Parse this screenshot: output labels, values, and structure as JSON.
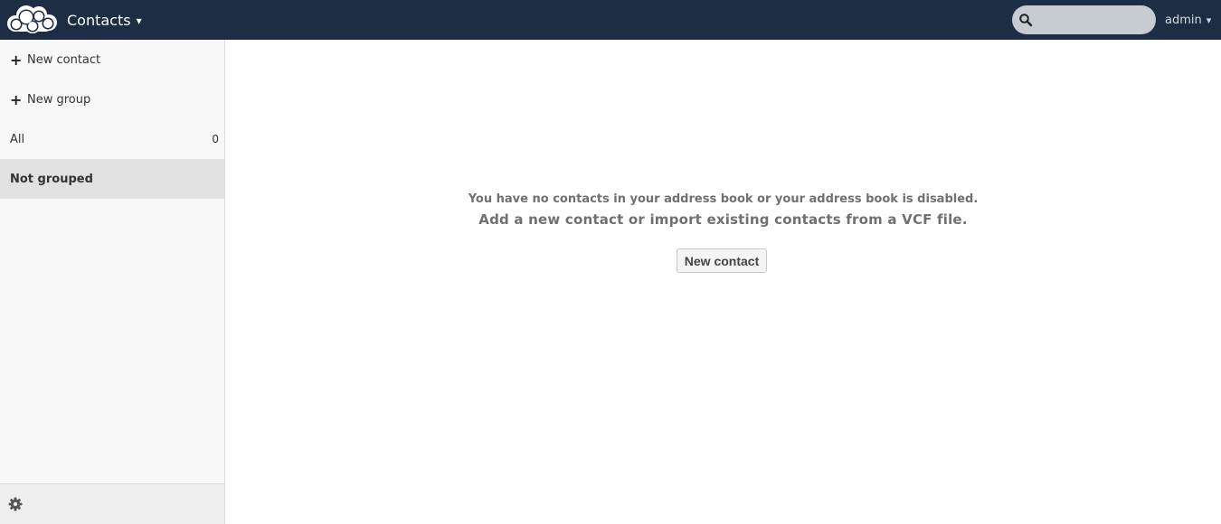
{
  "header": {
    "app_title": "Contacts",
    "app_caret": "▾",
    "search": {
      "value": "",
      "placeholder": ""
    },
    "user": {
      "name": "admin",
      "caret": "▾"
    },
    "colors": {
      "bar": "#1d2d44"
    }
  },
  "sidebar": {
    "new_contact_label": "New contact",
    "new_group_label": "New group",
    "plus_glyph": "+",
    "groups": [
      {
        "label": "All",
        "count": "0"
      },
      {
        "label": "Not grouped",
        "count": ""
      }
    ],
    "active_group": "Not grouped",
    "settings_icon": "gear-icon"
  },
  "main": {
    "empty_line1": "You have no contacts in your address book or your address book is disabled.",
    "empty_line2": "Add a new contact or import existing contacts from a VCF file.",
    "new_contact_button": "New contact"
  }
}
